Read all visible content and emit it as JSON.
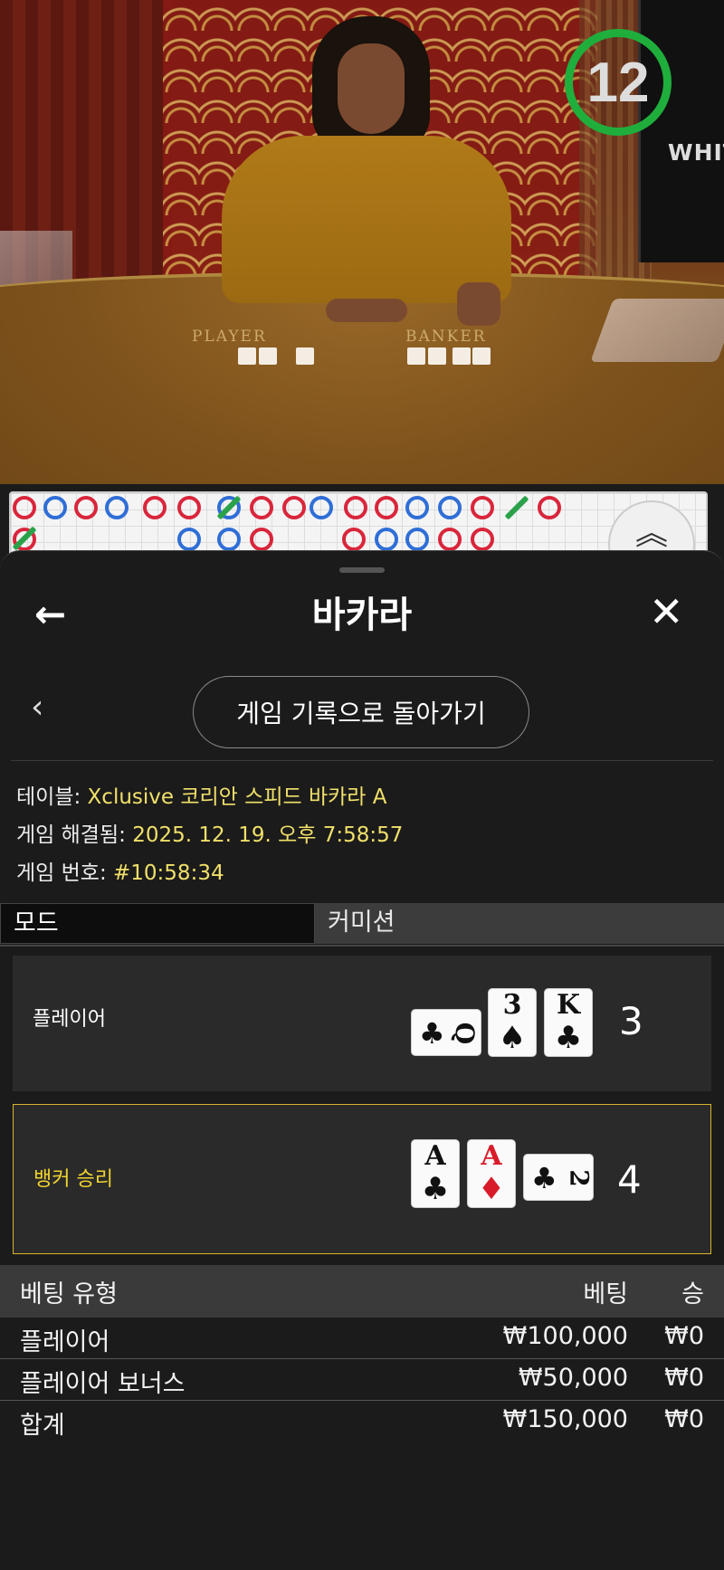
{
  "video": {
    "countdown": "12",
    "monitor_text": "WHITE",
    "felt_labels": [
      "PLAYER",
      "BANKER"
    ]
  },
  "road_map": {
    "colors": {
      "player": "#2f6ed6",
      "banker": "#d9263b",
      "tie": "#2aa24a"
    }
  },
  "panel": {
    "title": "바카라",
    "back_icon": "arrow-left-icon",
    "close_icon": "close-icon",
    "history_button": "게임 기록으로 돌아가기",
    "info": {
      "table_label": "테이블:",
      "table_value": "Xclusive 코리안 스피드 바카라 A",
      "resolved_label": "게임 해결됨:",
      "resolved_value": "2025. 12. 19. 오후 7:58:57",
      "game_no_label": "게임 번호:",
      "game_no_value": "#10:58:34"
    },
    "mode": {
      "left": "모드",
      "right": "커미션"
    },
    "hands": {
      "player": {
        "label": "플레이어",
        "total": "3",
        "cards": [
          {
            "rank": "Q",
            "suit": "♣",
            "color": "black",
            "orientation": "sideways"
          },
          {
            "rank": "3",
            "suit": "♠",
            "color": "black",
            "orientation": "upright"
          },
          {
            "rank": "K",
            "suit": "♣",
            "color": "black",
            "orientation": "upright"
          }
        ]
      },
      "banker": {
        "label": "뱅커 승리",
        "total": "4",
        "winner": true,
        "cards": [
          {
            "rank": "A",
            "suit": "♣",
            "color": "black",
            "orientation": "upright"
          },
          {
            "rank": "A",
            "suit": "♦",
            "color": "red",
            "orientation": "upright"
          },
          {
            "rank": "2",
            "suit": "♣",
            "color": "black",
            "orientation": "sideways"
          }
        ]
      }
    },
    "bets": {
      "headers": {
        "type": "베팅 유형",
        "bet": "베팅",
        "win": "승"
      },
      "rows": [
        {
          "type": "플레이어",
          "bet": "₩100,000",
          "win": "₩0"
        },
        {
          "type": "플레이어 보너스",
          "bet": "₩50,000",
          "win": "₩0"
        }
      ],
      "total": {
        "type": "합계",
        "bet": "₩150,000",
        "win": "₩0"
      }
    },
    "accent_color": "#f0e06a",
    "win_border_color": "#d9b32a"
  }
}
